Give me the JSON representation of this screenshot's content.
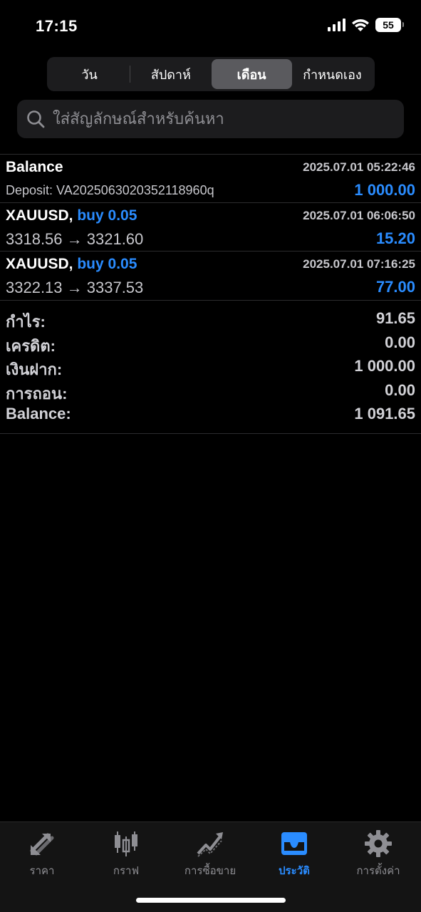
{
  "status_bar": {
    "time": "17:15",
    "battery": "55"
  },
  "period_tabs": [
    {
      "label": "วัน",
      "active": false
    },
    {
      "label": "สัปดาห์",
      "active": false
    },
    {
      "label": "เดือน",
      "active": true
    },
    {
      "label": "กำหนดเอง",
      "active": false
    }
  ],
  "search": {
    "placeholder": "ใส่สัญลักษณ์สำหรับค้นหา",
    "value": ""
  },
  "history": [
    {
      "title": "Balance",
      "side": "",
      "datetime": "2025.07.01 05:22:46",
      "detail": "Deposit: VA2025063020352118960q",
      "amount": "1 000.00"
    },
    {
      "title": "XAUUSD,",
      "side": "buy 0.05",
      "datetime": "2025.07.01 06:06:50",
      "detail": "3318.56 → 3321.60",
      "amount": "15.20"
    },
    {
      "title": "XAUUSD,",
      "side": "buy 0.05",
      "datetime": "2025.07.01 07:16:25",
      "detail": "3322.13 → 3337.53",
      "amount": "77.00"
    }
  ],
  "summary": [
    {
      "label": "กำไร:",
      "value": "91.65"
    },
    {
      "label": "เครดิต:",
      "value": "0.00"
    },
    {
      "label": "เงินฝาก:",
      "value": "1 000.00"
    },
    {
      "label": "การถอน:",
      "value": "0.00"
    },
    {
      "label": "Balance:",
      "value": "1 091.65"
    }
  ],
  "tabbar": [
    {
      "label": "ราคา",
      "icon": "quotes-arrows-icon",
      "active": false
    },
    {
      "label": "กราฟ",
      "icon": "candlestick-chart-icon",
      "active": false
    },
    {
      "label": "การซื้อขาย",
      "icon": "trade-chart-icon",
      "active": false
    },
    {
      "label": "ประวัติ",
      "icon": "history-tray-icon",
      "active": true
    },
    {
      "label": "การตั้งค่า",
      "icon": "gear-icon",
      "active": false
    }
  ],
  "colors": {
    "accent": "#2a8cff",
    "background": "#000000",
    "segment_active": "#5a5a5e"
  }
}
